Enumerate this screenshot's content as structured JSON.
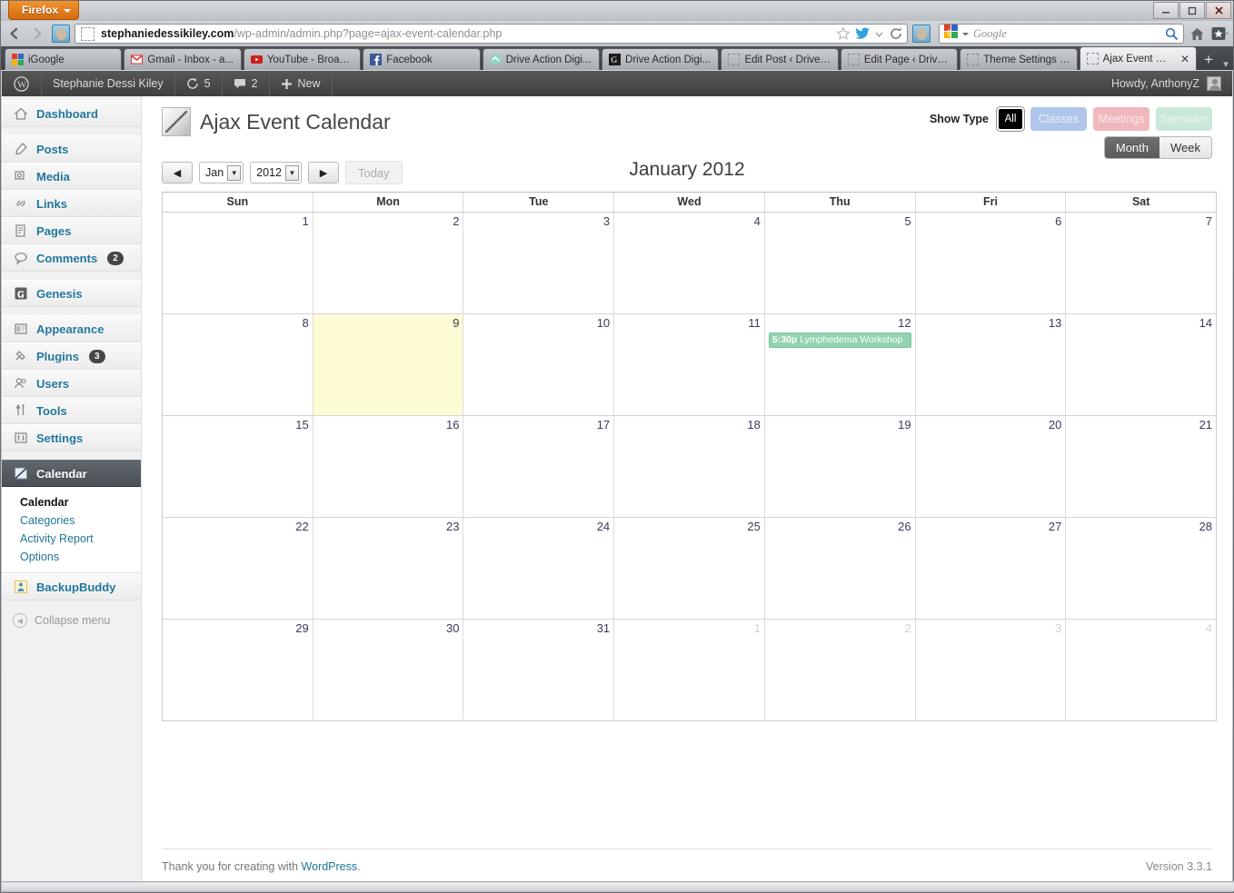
{
  "browser": {
    "app_button": "Firefox",
    "window_controls": {
      "minimize": "—",
      "maximize": "❐",
      "close": "✕"
    },
    "url": {
      "domain": "stephaniedessikiley.com",
      "path": "/wp-admin/admin.php?page=ajax-event-calendar.php"
    },
    "search": {
      "engine": "Google",
      "placeholder": "Google"
    },
    "tabs": [
      {
        "label": "iGoogle",
        "favicon": "google-icon",
        "active": false
      },
      {
        "label": "Gmail - Inbox - a...",
        "favicon": "gmail-icon",
        "active": false
      },
      {
        "label": "YouTube - Broad...",
        "favicon": "youtube-icon",
        "active": false
      },
      {
        "label": "Facebook",
        "favicon": "facebook-icon",
        "active": false
      },
      {
        "label": "Drive Action Digi...",
        "favicon": "drive-action-icon",
        "active": false
      },
      {
        "label": "Drive Action Digi...",
        "favicon": "genesis-icon",
        "active": false
      },
      {
        "label": "Edit Post ‹ Drive ...",
        "favicon": "blank-icon",
        "active": false
      },
      {
        "label": "Edit Page ‹ Drive ...",
        "favicon": "blank-icon",
        "active": false
      },
      {
        "label": "Theme Settings ‹ ...",
        "favicon": "blank-icon",
        "active": false
      },
      {
        "label": "Ajax Event Cal...",
        "favicon": "blank-icon",
        "active": true
      }
    ],
    "new_tab": "+",
    "list_all_tabs": "▾"
  },
  "adminbar": {
    "site_name": "Stephanie Dessi Kiley",
    "updates_count": "5",
    "comments_count": "2",
    "new_label": "New",
    "howdy": "Howdy, AnthonyZ"
  },
  "sidebar": {
    "items": [
      {
        "label": "Dashboard",
        "icon": "dashboard-icon",
        "badge": ""
      },
      {
        "label": "Posts",
        "icon": "posts-pin-icon",
        "badge": ""
      },
      {
        "label": "Media",
        "icon": "media-icon",
        "badge": ""
      },
      {
        "label": "Links",
        "icon": "links-icon",
        "badge": ""
      },
      {
        "label": "Pages",
        "icon": "pages-icon",
        "badge": ""
      },
      {
        "label": "Comments",
        "icon": "comments-icon",
        "badge": "2"
      },
      {
        "label": "Genesis",
        "icon": "genesis-icon",
        "badge": ""
      },
      {
        "label": "Appearance",
        "icon": "appearance-icon",
        "badge": ""
      },
      {
        "label": "Plugins",
        "icon": "plugins-icon",
        "badge": "3"
      },
      {
        "label": "Users",
        "icon": "users-icon",
        "badge": ""
      },
      {
        "label": "Tools",
        "icon": "tools-icon",
        "badge": ""
      },
      {
        "label": "Settings",
        "icon": "settings-icon",
        "badge": ""
      }
    ],
    "current": {
      "label": "Calendar",
      "icon": "calendar-icon"
    },
    "submenu": [
      {
        "label": "Calendar",
        "current": true
      },
      {
        "label": "Categories",
        "current": false
      },
      {
        "label": "Activity Report",
        "current": false
      },
      {
        "label": "Options",
        "current": false
      }
    ],
    "backupbuddy": {
      "label": "BackupBuddy",
      "icon": "backupbuddy-icon"
    },
    "collapse": "Collapse menu"
  },
  "main": {
    "page_title": "Ajax Event Calendar",
    "show_type_label": "Show Type",
    "type_buttons": [
      {
        "label": "All",
        "key": "all",
        "color": "#000000",
        "active": true
      },
      {
        "label": "Classes",
        "key": "classes",
        "color": "#afc6ea",
        "active": false
      },
      {
        "label": "Meetings",
        "key": "meetings",
        "color": "#f0b8bd",
        "active": false
      },
      {
        "label": "Seminars",
        "key": "seminars",
        "color": "#c9e8d8",
        "active": false
      }
    ],
    "view_toggle": [
      {
        "label": "Month",
        "active": true
      },
      {
        "label": "Week",
        "active": false
      }
    ],
    "nav": {
      "prev": "◀",
      "next": "▶",
      "today": "Today",
      "month_value": "Jan",
      "year_value": "2012"
    },
    "month_title": "January 2012"
  },
  "chart_data": {
    "type": "table",
    "title": "January 2012",
    "weekday_headers": [
      "Sun",
      "Mon",
      "Tue",
      "Wed",
      "Thu",
      "Fri",
      "Sat"
    ],
    "weeks": [
      [
        {
          "day": "1",
          "other": false,
          "today": false,
          "events": []
        },
        {
          "day": "2",
          "other": false,
          "today": false,
          "events": []
        },
        {
          "day": "3",
          "other": false,
          "today": false,
          "events": []
        },
        {
          "day": "4",
          "other": false,
          "today": false,
          "events": []
        },
        {
          "day": "5",
          "other": false,
          "today": false,
          "events": []
        },
        {
          "day": "6",
          "other": false,
          "today": false,
          "events": []
        },
        {
          "day": "7",
          "other": false,
          "today": false,
          "events": []
        }
      ],
      [
        {
          "day": "8",
          "other": false,
          "today": false,
          "events": []
        },
        {
          "day": "9",
          "other": false,
          "today": true,
          "events": []
        },
        {
          "day": "10",
          "other": false,
          "today": false,
          "events": []
        },
        {
          "day": "11",
          "other": false,
          "today": false,
          "events": []
        },
        {
          "day": "12",
          "other": false,
          "today": false,
          "events": [
            {
              "time": "5:30p",
              "title": "Lymphedema Workshop",
              "color": "#93d2b3"
            }
          ]
        },
        {
          "day": "13",
          "other": false,
          "today": false,
          "events": []
        },
        {
          "day": "14",
          "other": false,
          "today": false,
          "events": []
        }
      ],
      [
        {
          "day": "15",
          "other": false,
          "today": false,
          "events": []
        },
        {
          "day": "16",
          "other": false,
          "today": false,
          "events": []
        },
        {
          "day": "17",
          "other": false,
          "today": false,
          "events": []
        },
        {
          "day": "18",
          "other": false,
          "today": false,
          "events": []
        },
        {
          "day": "19",
          "other": false,
          "today": false,
          "events": []
        },
        {
          "day": "20",
          "other": false,
          "today": false,
          "events": []
        },
        {
          "day": "21",
          "other": false,
          "today": false,
          "events": []
        }
      ],
      [
        {
          "day": "22",
          "other": false,
          "today": false,
          "events": []
        },
        {
          "day": "23",
          "other": false,
          "today": false,
          "events": []
        },
        {
          "day": "24",
          "other": false,
          "today": false,
          "events": []
        },
        {
          "day": "25",
          "other": false,
          "today": false,
          "events": []
        },
        {
          "day": "26",
          "other": false,
          "today": false,
          "events": []
        },
        {
          "day": "27",
          "other": false,
          "today": false,
          "events": []
        },
        {
          "day": "28",
          "other": false,
          "today": false,
          "events": []
        }
      ],
      [
        {
          "day": "29",
          "other": false,
          "today": false,
          "events": []
        },
        {
          "day": "30",
          "other": false,
          "today": false,
          "events": []
        },
        {
          "day": "31",
          "other": false,
          "today": false,
          "events": []
        },
        {
          "day": "1",
          "other": true,
          "today": false,
          "events": []
        },
        {
          "day": "2",
          "other": true,
          "today": false,
          "events": []
        },
        {
          "day": "3",
          "other": true,
          "today": false,
          "events": []
        },
        {
          "day": "4",
          "other": true,
          "today": false,
          "events": []
        }
      ]
    ]
  },
  "footer": {
    "thanks_prefix": "Thank you for creating with ",
    "wordpress_link": "WordPress",
    "thanks_suffix": ".",
    "version": "Version 3.3.1"
  }
}
